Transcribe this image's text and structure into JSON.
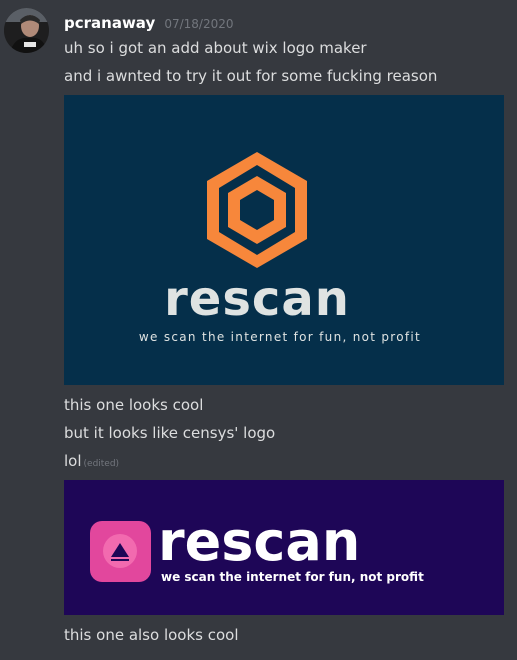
{
  "message": {
    "author": "pcranaway",
    "timestamp": "07/18/2020",
    "lines": [
      "uh so i got an add about wix logo maker",
      "and i awnted to try it out for some fucking reason",
      "this one looks cool",
      "but it looks like censys' logo",
      "lol",
      "this one also looks cool"
    ],
    "edited_label": "(edited)"
  },
  "attachments": [
    {
      "wordmark": "rescan",
      "tagline": "we scan the internet for fun, not profit",
      "background": "#052f4a",
      "accent": "#f7873b",
      "text_color": "#dfe3e2",
      "icon": "hexagon-logo-icon"
    },
    {
      "wordmark": "rescan",
      "tagline": "we scan the internet for fun, not profit",
      "background": "#1e0657",
      "accent": "#e2479d",
      "text_color": "#ffffff",
      "icon": "triangle-badge-logo-icon"
    }
  ]
}
